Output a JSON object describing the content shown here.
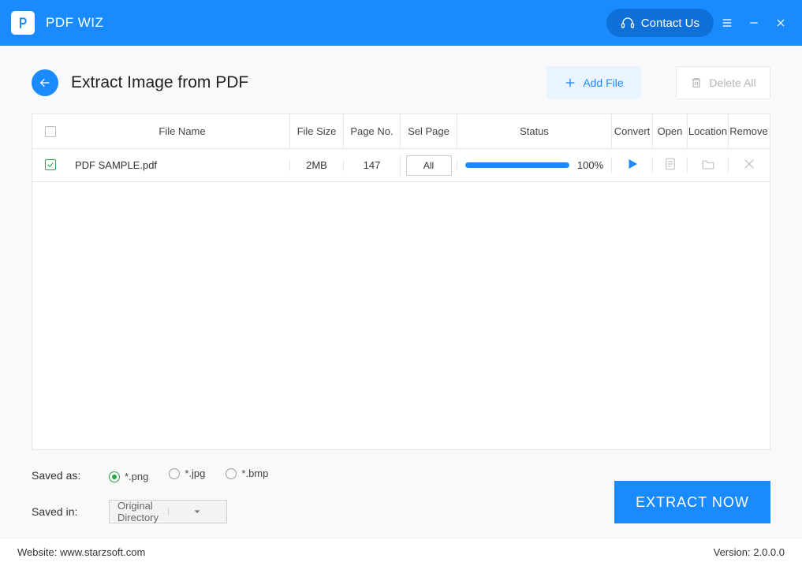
{
  "app_name": "PDF WIZ",
  "contact_label": "Contact Us",
  "page_title": "Extract Image from PDF",
  "buttons": {
    "add_file": "Add File",
    "delete_all": "Delete All",
    "extract": "EXTRACT NOW"
  },
  "columns": {
    "file_name": "File Name",
    "file_size": "File Size",
    "page_no": "Page No.",
    "sel_page": "Sel Page",
    "status": "Status",
    "convert": "Convert",
    "open": "Open",
    "location": "Location",
    "remove": "Remove"
  },
  "rows": [
    {
      "checked": true,
      "file_name": "PDF SAMPLE.pdf",
      "file_size": "2MB",
      "page_no": "147",
      "sel_page": "All",
      "progress": 100,
      "progress_label": "100%"
    }
  ],
  "save_as_label": "Saved as:",
  "save_in_label": "Saved in:",
  "formats": [
    {
      "name": "*.png",
      "selected": true
    },
    {
      "name": "*.jpg",
      "selected": false
    },
    {
      "name": "*.bmp",
      "selected": false
    }
  ],
  "save_dir": "Original Directory",
  "footer_website_label": "Website:",
  "footer_website": "www.starzsoft.com",
  "footer_version_label": "Version:",
  "footer_version": "2.0.0.0"
}
